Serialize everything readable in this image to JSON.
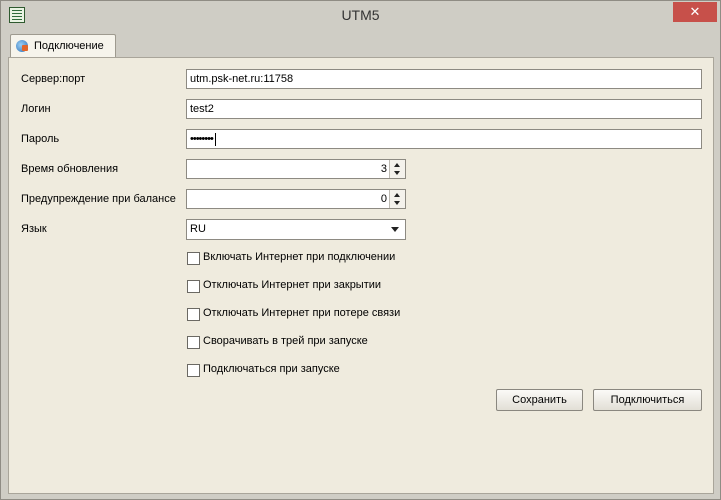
{
  "window": {
    "title": "UTM5",
    "close_glyph": "✕",
    "app_icon": "app-list-icon"
  },
  "tabs": [
    {
      "label": "Подключение",
      "icon": "globe-connection-icon",
      "active": true
    }
  ],
  "form": {
    "server": {
      "label": "Сервер:порт",
      "value": "utm.psk-net.ru:11758"
    },
    "login": {
      "label": "Логин",
      "value": "test2"
    },
    "password": {
      "label": "Пароль",
      "value": "••••••••"
    },
    "refresh": {
      "label": "Время обновления",
      "value": "3"
    },
    "balance_warning": {
      "label": "Предупреждение при балансе",
      "value": "0"
    },
    "language": {
      "label": "Язык",
      "value": "RU"
    }
  },
  "checkboxes": [
    {
      "label": "Включать Интернет при подключении",
      "checked": false
    },
    {
      "label": "Отключать Интернет при закрытии",
      "checked": false
    },
    {
      "label": "Отключать Интернет при потере связи",
      "checked": false
    },
    {
      "label": "Сворачивать в трей при запуске",
      "checked": false
    },
    {
      "label": "Подключаться при запуске",
      "checked": false
    }
  ],
  "buttons": {
    "save": "Сохранить",
    "connect": "Подключиться"
  },
  "colors": {
    "close_button": "#c7504a",
    "panel": "#efebde",
    "frame": "#cfcdc5"
  }
}
